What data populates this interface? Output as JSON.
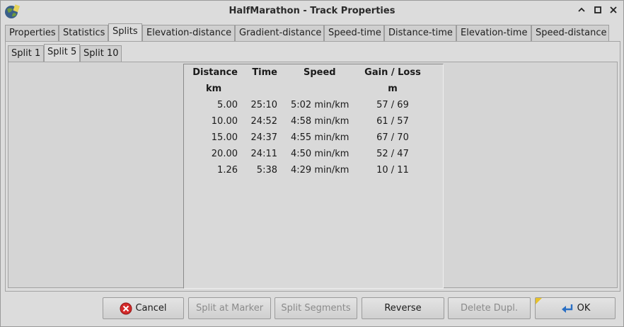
{
  "window": {
    "title": "HalfMarathon - Track Properties"
  },
  "tabs": [
    {
      "label": "Properties"
    },
    {
      "label": "Statistics"
    },
    {
      "label": "Splits"
    },
    {
      "label": "Elevation-distance"
    },
    {
      "label": "Gradient-distance"
    },
    {
      "label": "Speed-time"
    },
    {
      "label": "Distance-time"
    },
    {
      "label": "Elevation-time"
    },
    {
      "label": "Speed-distance"
    }
  ],
  "active_tab": "Splits",
  "subtabs": [
    {
      "label": "Split 1"
    },
    {
      "label": "Split 5"
    },
    {
      "label": "Split 10"
    }
  ],
  "active_subtab": "Split 5",
  "splits_table": {
    "headers": {
      "distance": "Distance",
      "time": "Time",
      "speed": "Speed",
      "gain_loss": "Gain / Loss"
    },
    "units": {
      "distance": "km",
      "gain_loss": "m"
    },
    "rows": [
      {
        "distance": "5.00",
        "time": "25:10",
        "speed": "5:02 min/km",
        "gain_loss": "57 / 69"
      },
      {
        "distance": "10.00",
        "time": "24:52",
        "speed": "4:58 min/km",
        "gain_loss": "61 / 57"
      },
      {
        "distance": "15.00",
        "time": "24:37",
        "speed": "4:55 min/km",
        "gain_loss": "67 / 70"
      },
      {
        "distance": "20.00",
        "time": "24:11",
        "speed": "4:50 min/km",
        "gain_loss": "52 / 47"
      },
      {
        "distance": "1.26",
        "time": "5:38",
        "speed": "4:29 min/km",
        "gain_loss": "10 / 11"
      }
    ]
  },
  "buttons": {
    "cancel": "Cancel",
    "split_at_marker": "Split at Marker",
    "split_segments": "Split Segments",
    "reverse": "Reverse",
    "delete_dupl": "Delete Dupl.",
    "ok": "OK"
  },
  "colors": {
    "cancel_icon": "#d42a2a",
    "ok_icon": "#2a6fc4"
  }
}
